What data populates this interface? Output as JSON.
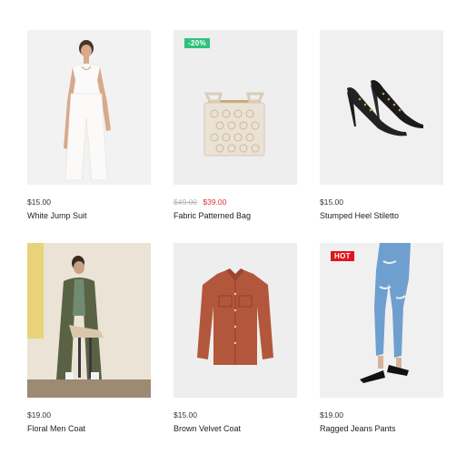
{
  "products": [
    {
      "name": "White Jump Suit",
      "price": "$15.00",
      "image": "woman-white-jumpsuit-photo"
    },
    {
      "name": "Fabric Patterned Bag",
      "old_price": "$49.00",
      "price": "$39.00",
      "badge": "-20%",
      "badge_color": "#2ec27e",
      "image": "cream-crochet-bag-photo"
    },
    {
      "name": "Stumped Heel Stiletto",
      "price": "$15.00",
      "image": "black-studded-stiletto-photo"
    },
    {
      "name": "Floral Men Coat",
      "price": "$19.00",
      "image": "man-green-coat-photo"
    },
    {
      "name": "Brown Velvet Coat",
      "price": "$15.00",
      "image": "brown-shirt-jacket-photo"
    },
    {
      "name": "Ragged Jeans Pants",
      "price": "$19.00",
      "badge": "HOT",
      "badge_color": "#e0161d",
      "image": "ripped-blue-jeans-photo"
    }
  ],
  "colors": {
    "sale_price": "#e3313a",
    "old_price": "#b5b5b5"
  }
}
